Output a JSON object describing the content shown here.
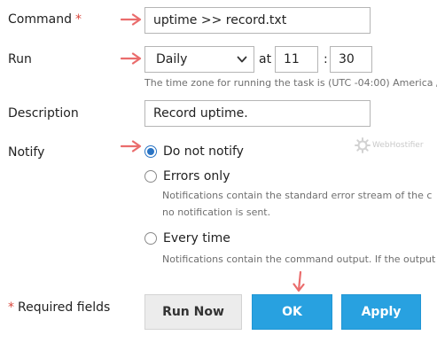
{
  "form": {
    "command": {
      "label": "Command",
      "required_mark": "*",
      "value": "uptime >> record.txt"
    },
    "run": {
      "label": "Run",
      "frequency_selected": "Daily",
      "at_label": "at",
      "hour": "11",
      "time_separator": ":",
      "minute": "30",
      "timezone_hint": "The time zone for running the task is (UTC -04:00) America /"
    },
    "description": {
      "label": "Description",
      "value": "Record uptime."
    },
    "notify": {
      "label": "Notify",
      "options": [
        {
          "label": "Do not notify",
          "checked": true
        },
        {
          "label": "Errors only",
          "checked": false,
          "hint_line1": "Notifications contain the standard error stream of the c",
          "hint_line2": "no notification is sent."
        },
        {
          "label": "Every time",
          "checked": false,
          "hint_line1": "Notifications contain the command output. If the output"
        }
      ]
    }
  },
  "footer": {
    "required_star": "*",
    "required_text": "Required fields",
    "run_now_label": "Run Now",
    "ok_label": "OK",
    "apply_label": "Apply"
  },
  "watermark": {
    "text": "WebHostifier"
  },
  "colors": {
    "primary_button": "#28a1e0",
    "required_star": "#d9463b",
    "annotation_arrow": "#ea6c6c",
    "radio_checked": "#2a74c4"
  },
  "icons": {
    "select_caret": "chevron-down-icon",
    "annotation": "arrow-right-icon"
  }
}
